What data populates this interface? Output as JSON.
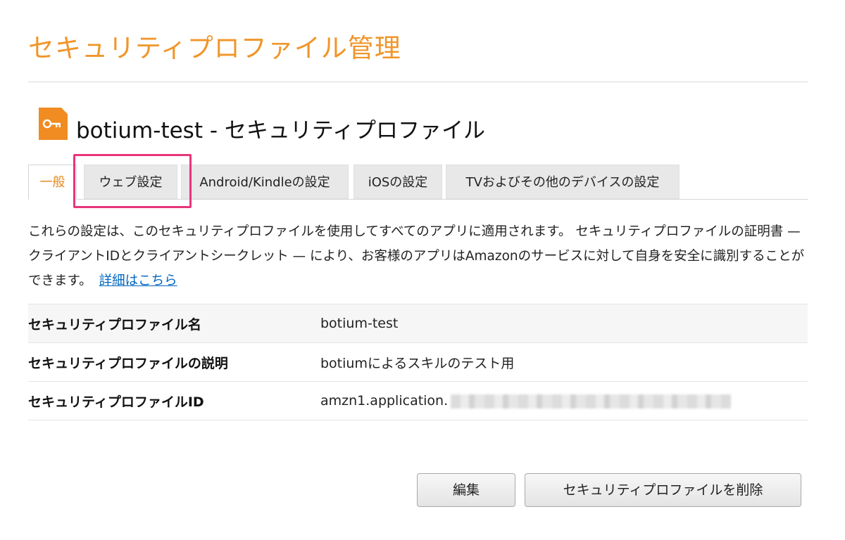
{
  "page": {
    "title": "セキュリティプロファイル管理"
  },
  "profile": {
    "heading": "botium-test - セキュリティプロファイル"
  },
  "tabs": [
    {
      "label": "一般",
      "active": true
    },
    {
      "label": "ウェブ設定",
      "active": false,
      "highlighted": true
    },
    {
      "label": "Android/Kindleの設定",
      "active": false
    },
    {
      "label": "iOSの設定",
      "active": false
    },
    {
      "label": "TVおよびその他のデバイスの設定",
      "active": false
    }
  ],
  "description": {
    "text": "これらの設定は、このセキュリティプロファイルを使用してすべてのアプリに適用されます。 セキュリティプロファイルの証明書 — クライアントIDとクライアントシークレット — により、お客様のアプリはAmazonのサービスに対して自身を安全に識別することができます。",
    "link": "詳細はこちら"
  },
  "details": [
    {
      "label": "セキュリティプロファイル名",
      "value": "botium-test"
    },
    {
      "label": "セキュリティプロファイルの説明",
      "value": "botiumによるスキルのテスト用"
    },
    {
      "label": "セキュリティプロファイルID",
      "value": "amzn1.application."
    }
  ],
  "buttons": {
    "edit": "編集",
    "delete": "セキュリティプロファイルを削除"
  },
  "colors": {
    "accent": "#f0962a",
    "highlight": "#e8357a",
    "link": "#0066c0"
  }
}
